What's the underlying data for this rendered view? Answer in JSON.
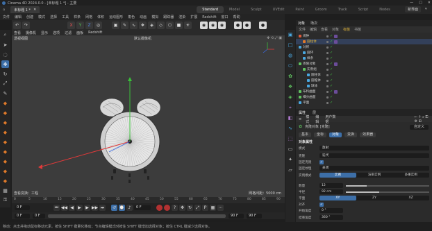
{
  "window": {
    "title": "Cinema 4D 2024.0.0 - [未标题 1 *] - 主要",
    "controls": [
      "—",
      "□",
      "✕"
    ]
  },
  "tabs": {
    "document": "未标题 1 *",
    "layouts": [
      "Standard",
      "Model",
      "Sculpt",
      "UVEdit",
      "Paint",
      "Groom",
      "Track",
      "Script",
      "Nodes"
    ],
    "active_layout": "Standard",
    "new_layout": "新界面"
  },
  "menu": [
    "文件",
    "编辑",
    "创建",
    "模式",
    "选择",
    "工具",
    "样条",
    "网格",
    "体积",
    "运动图形",
    "角色",
    "动画",
    "模拟",
    "跟踪器",
    "渲染",
    "扩展",
    "Redshift",
    "窗口",
    "帮助"
  ],
  "viewport": {
    "menu": [
      "查看",
      "摄像机",
      "显示",
      "选项",
      "过滤",
      "面板",
      "Redshift"
    ],
    "label": "透视视图",
    "camera": "默认摄像机",
    "speed_label": "查看变换：工程",
    "grid_label": "网格间距：5000 cm"
  },
  "timeline": {
    "ticks": [
      "0",
      "5",
      "10",
      "15",
      "20",
      "25",
      "30",
      "35",
      "40",
      "45",
      "50",
      "55",
      "60",
      "65",
      "70",
      "75",
      "80",
      "85",
      "90"
    ],
    "current_frame": "0 F",
    "frame_field": "0 F",
    "start": "0 F",
    "end": "90 F",
    "end2": "90 F",
    "fps": "0 F"
  },
  "status": "移动：点击并拖动鼠标移动元素。按住 SHIFT 键量化移动；节点编辑模式时按住 SHIFT 键增加选择对象；按住 CTRL 键减少选择对象。",
  "object_manager": {
    "tabs": [
      "对象",
      "场次"
    ],
    "menu": [
      "文件",
      "编辑",
      "查看",
      "对象",
      "标签",
      "书签"
    ],
    "rows": [
      {
        "name": "闹钟",
        "indent": 0,
        "color": "#e05a3a"
      },
      {
        "name": "圆柱体",
        "indent": 1,
        "color": "#e07a2a"
      },
      {
        "name": "对称",
        "indent": 0,
        "color": "#4aa8e0"
      },
      {
        "name": "圆环",
        "indent": 1,
        "color": "#4aa8e0"
      },
      {
        "name": "样条",
        "indent": 1,
        "color": "#4aa8e0"
      },
      {
        "name": "克隆对象",
        "indent": 0,
        "color": "#5fc35f"
      },
      {
        "name": "实例组",
        "indent": 1,
        "color": "#5fc35f"
      },
      {
        "name": "圆柱体",
        "indent": 2,
        "color": "#4aa8e0"
      },
      {
        "name": "圆锥体",
        "indent": 2,
        "color": "#4aa8e0"
      },
      {
        "name": "球体",
        "indent": 2,
        "color": "#4aa8e0"
      },
      {
        "name": "布料曲面",
        "indent": 0,
        "color": "#5fc35f"
      },
      {
        "name": "细分曲面",
        "indent": 0,
        "color": "#5fc35f"
      },
      {
        "name": "平面",
        "indent": 0,
        "color": "#4aa8e0"
      }
    ]
  },
  "attributes": {
    "tabs": [
      "属性",
      "层"
    ],
    "menu": [
      "模式",
      "编辑",
      "用户数据"
    ],
    "title": "克隆对象 [克隆]",
    "layer_button": "自定义",
    "subtabs": [
      "基本",
      "坐标",
      "对象",
      "变换",
      "效果器"
    ],
    "active_subtab": "对象",
    "section": "对象属性",
    "mode_label": "模式",
    "mode_value": "放射",
    "clones_label": "克隆",
    "clones_value": "迭代",
    "fixed_clone_label": "固定克隆",
    "fixed_texture_label": "固定纹理",
    "fixed_texture_value": "关闭",
    "instance_label": "实例模式",
    "instance_options": [
      "实例",
      "渲染实例",
      "多重实例"
    ],
    "instance_active": "实例",
    "count_label": "数量",
    "count_value": "12",
    "count_fraction": 0.25,
    "radius_label": "半径",
    "radius_value": "92 cm",
    "radius_fraction": 0.4,
    "plane_label": "平面",
    "plane_options": [
      "XY",
      "ZY",
      "XZ"
    ],
    "plane_active": "XY",
    "align_label": "对齐",
    "start_label": "开始角度",
    "start_value": "0 °",
    "end_label": "结束角度",
    "end_value": "360 °"
  },
  "colors": {
    "accent": "#3d6fa8",
    "record": "#b23131",
    "check": "#46c846"
  }
}
